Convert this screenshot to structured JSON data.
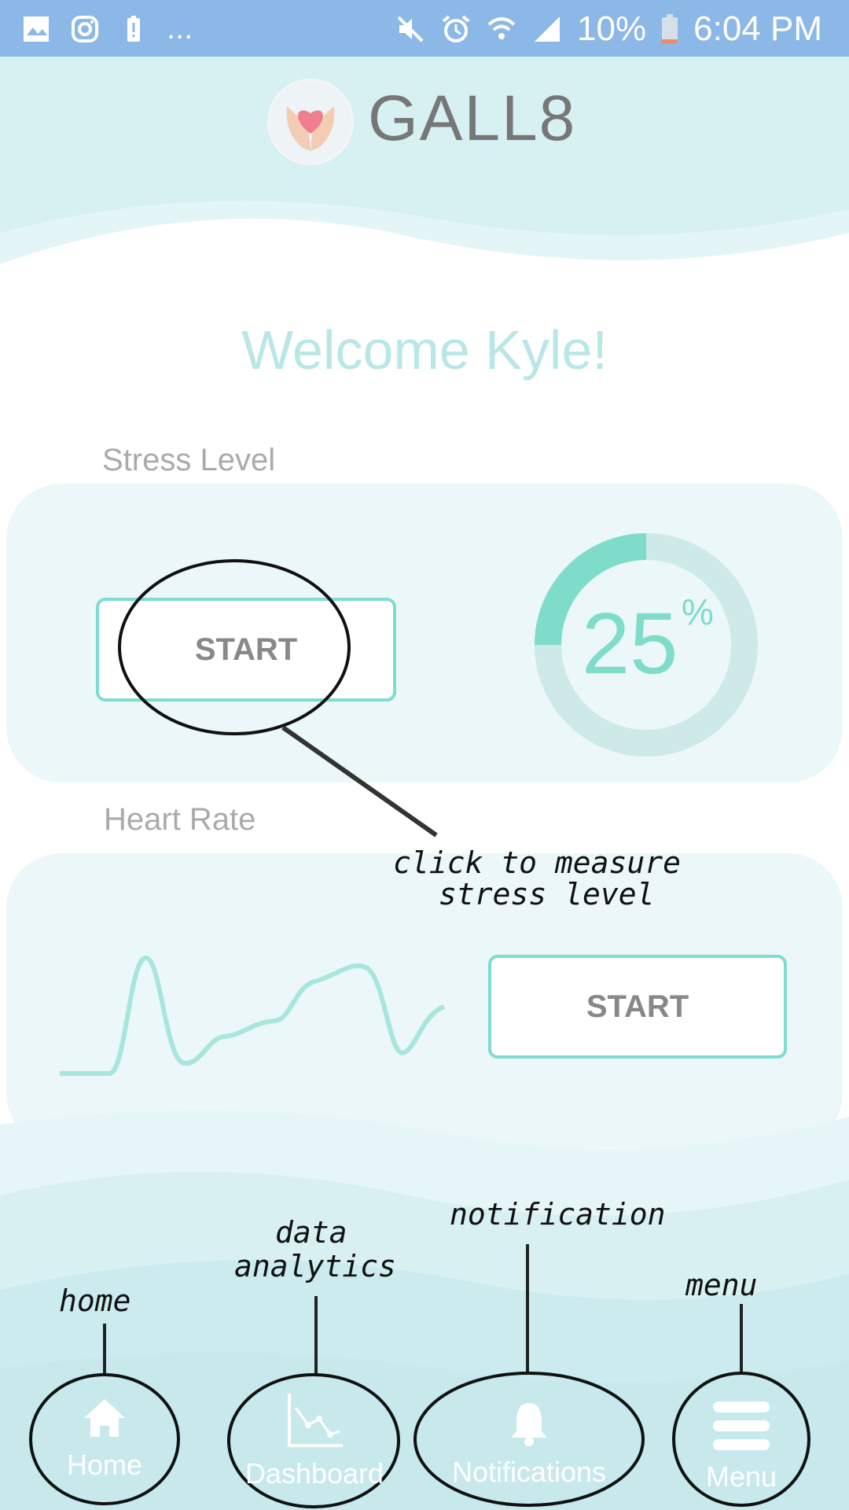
{
  "status_bar": {
    "battery": "10%",
    "time": "6:04 PM",
    "more": "..."
  },
  "header": {
    "title": "GALL8"
  },
  "welcome": "Welcome Kyle!",
  "stress": {
    "label": "Stress Level",
    "button": "START",
    "percent": "25",
    "percent_sign": "%",
    "progress_fraction": 0.25
  },
  "heart": {
    "label": "Heart Rate",
    "button": "START"
  },
  "annotations": {
    "stress_note_line1": "click to measure",
    "stress_note_line2": "stress level",
    "home": "home",
    "data_line1": "data",
    "data_line2": "analytics",
    "notification": "notification",
    "menu": "menu"
  },
  "nav": {
    "items": [
      {
        "label": "Home",
        "icon": "home-icon"
      },
      {
        "label": "Dashboard",
        "icon": "chart-icon"
      },
      {
        "label": "Notifications",
        "icon": "bell-icon"
      },
      {
        "label": "Menu",
        "icon": "menu-icon"
      }
    ]
  },
  "colors": {
    "accent": "#7fdccb",
    "status_bar": "#8cb8e8",
    "card": "#ebf7f8"
  }
}
